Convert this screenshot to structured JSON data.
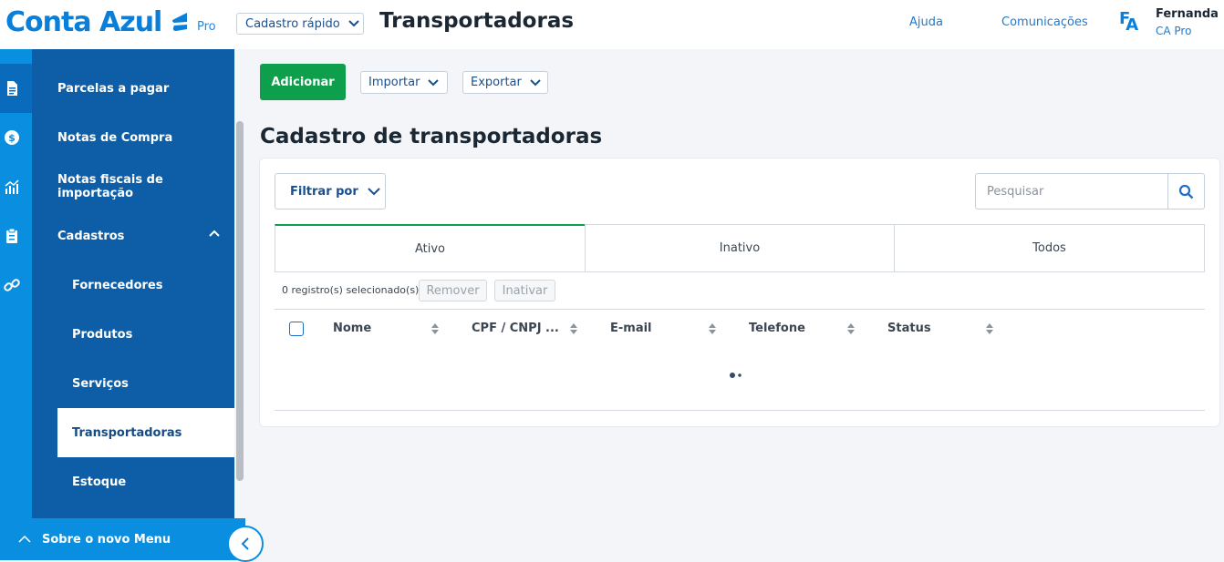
{
  "header": {
    "logo_text": "Conta Azul",
    "logo_suffix": "Pro",
    "quick_register_label": "Cadastro rápido",
    "page_title": "Transportadoras",
    "help_link": "Ajuda",
    "communications_link": "Comunicações",
    "avatar_initials": [
      "F",
      "A"
    ],
    "user_name": "Fernanda",
    "user_plan": "CA Pro"
  },
  "rail": {
    "icons": [
      "document-icon",
      "dollar-icon",
      "chart-icon",
      "clipboard-icon",
      "link-icon"
    ]
  },
  "sidebar": {
    "items": [
      {
        "label": "Parcelas a pagar"
      },
      {
        "label": "Notas de Compra"
      },
      {
        "label": "Notas fiscais de importação"
      },
      {
        "label": "Cadastros"
      },
      {
        "label": "Fornecedores"
      },
      {
        "label": "Produtos"
      },
      {
        "label": "Serviços"
      },
      {
        "label": "Transportadoras"
      },
      {
        "label": "Estoque"
      }
    ],
    "bottom_label": "Sobre o novo Menu"
  },
  "toolbar": {
    "add_label": "Adicionar",
    "import_label": "Importar",
    "export_label": "Exportar"
  },
  "main": {
    "section_title": "Cadastro de transportadoras",
    "filter_label": "Filtrar por",
    "search_placeholder": "Pesquisar",
    "tabs": [
      {
        "label": "Ativo"
      },
      {
        "label": "Inativo"
      },
      {
        "label": "Todos"
      }
    ],
    "selection_text": "0 registro(s) selecionado(s)",
    "remove_label": "Remover",
    "deactivate_label": "Inativar",
    "columns": [
      "Nome",
      "CPF / CNPJ ...",
      "E-mail",
      "Telefone",
      "Status"
    ]
  },
  "colors": {
    "brand_blue": "#0a7fd9",
    "sidebar_blue": "#0d5ea6",
    "rail_blue": "#0a8fe0",
    "success_green": "#0e9f4d"
  }
}
